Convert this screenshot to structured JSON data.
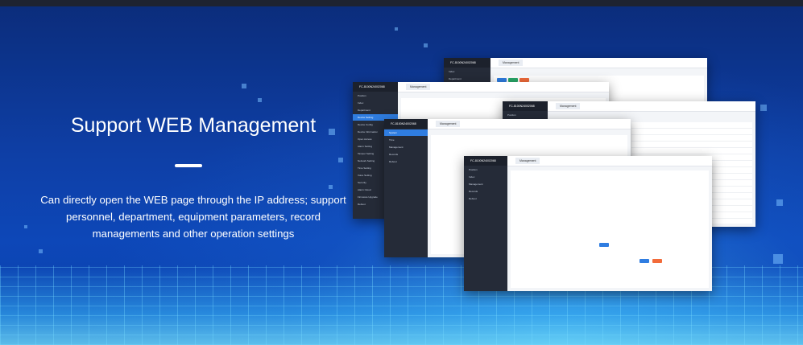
{
  "hero": {
    "title": "Support WEB Management",
    "description": "Can directly open the WEB page through the IP address; support personnel, department, equipment parameters, record managements and other operation settings"
  },
  "screenshots": [
    {
      "brand": "FC-8100N24002068",
      "tab": "Management",
      "items": [
        "Index",
        "Department",
        "Person",
        "Attendance"
      ],
      "active": 3
    },
    {
      "brand": "FC-8100N24002068",
      "tab": "Management",
      "items": [
        "Position",
        "Index",
        "Department",
        "Device Setting",
        "Device Config",
        "Device Information",
        "Open Access",
        "Alarm Setting",
        "Tamper Setting",
        "Network Setting",
        "Time Setting",
        "Voice Setting",
        "Security",
        "Alarm Cloud",
        "Firmware Upgrade",
        "Reboot"
      ],
      "active": 1
    },
    {
      "brand": "FC-8100N24002068",
      "tab": "Management",
      "items": [
        "Position"
      ],
      "active": 0
    },
    {
      "brand": "FC-8100N24002068",
      "tab": "Management",
      "items": [
        "System",
        "Time",
        "Management",
        "Records",
        "Reboot"
      ],
      "active": 0
    },
    {
      "brand": "FC-8100N24002068",
      "tab": "Management",
      "items": [
        "Position",
        "Index",
        "Management",
        "Records",
        "Reboot"
      ],
      "active": -1
    }
  ],
  "colors": {
    "accent": "#2f7de1",
    "danger": "#f26b3a",
    "background": "#0d47b8"
  }
}
